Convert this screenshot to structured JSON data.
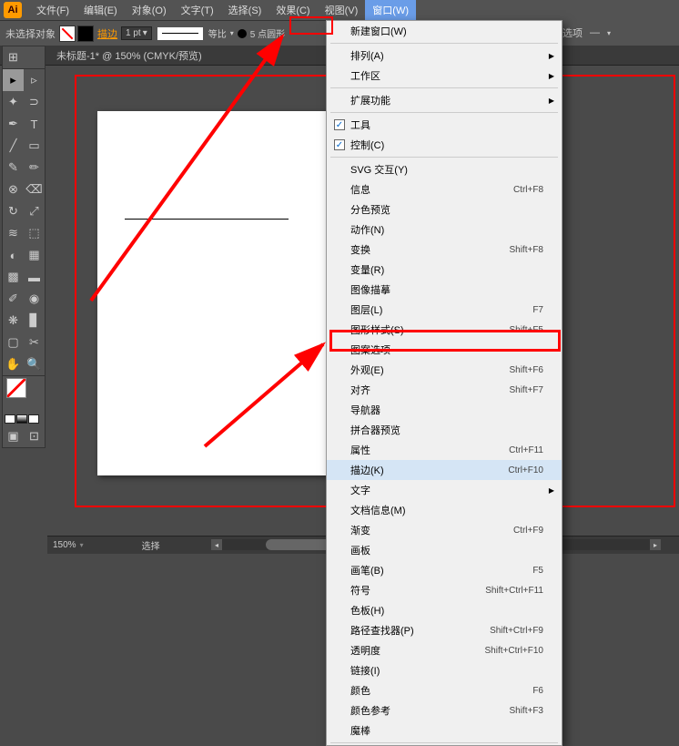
{
  "app": {
    "logo": "Ai"
  },
  "menubar": [
    {
      "label": "文件(F)"
    },
    {
      "label": "编辑(E)"
    },
    {
      "label": "对象(O)"
    },
    {
      "label": "文字(T)"
    },
    {
      "label": "选择(S)"
    },
    {
      "label": "效果(C)"
    },
    {
      "label": "视图(V)"
    },
    {
      "label": "窗口(W)",
      "active": true
    }
  ],
  "optionbar": {
    "noselection": "未选择对象",
    "stroke_link": "描边",
    "stroke_weight": "1 pt",
    "uniform": "等比",
    "shape_label": "5 点圆形"
  },
  "right_strip": {
    "option": "选项",
    "dash": "—"
  },
  "doc_tab": "未标题-1* @ 150% (CMYK/预览)",
  "menu": {
    "items": [
      {
        "label": "新建窗口(W)"
      },
      {
        "sep": true
      },
      {
        "label": "排列(A)",
        "sub": true
      },
      {
        "label": "工作区",
        "sub": true
      },
      {
        "sep": true
      },
      {
        "label": "扩展功能",
        "sub": true
      },
      {
        "sep": true
      },
      {
        "label": "工具",
        "checked": true
      },
      {
        "label": "控制(C)",
        "checked": true
      },
      {
        "sep": true
      },
      {
        "label": "SVG 交互(Y)"
      },
      {
        "label": "信息",
        "shortcut": "Ctrl+F8"
      },
      {
        "label": "分色预览"
      },
      {
        "label": "动作(N)"
      },
      {
        "label": "变换",
        "shortcut": "Shift+F8"
      },
      {
        "label": "变量(R)"
      },
      {
        "label": "图像描摹"
      },
      {
        "label": "图层(L)",
        "shortcut": "F7"
      },
      {
        "label": "图形样式(S)",
        "shortcut": "Shift+F5"
      },
      {
        "label": "图案选项"
      },
      {
        "label": "外观(E)",
        "shortcut": "Shift+F6"
      },
      {
        "label": "对齐",
        "shortcut": "Shift+F7"
      },
      {
        "label": "导航器"
      },
      {
        "label": "拼合器预览"
      },
      {
        "label": "属性",
        "shortcut": "Ctrl+F11"
      },
      {
        "label": "描边(K)",
        "shortcut": "Ctrl+F10",
        "highlighted": true
      },
      {
        "label": "文字",
        "sub": true
      },
      {
        "label": "文档信息(M)"
      },
      {
        "label": "渐变",
        "shortcut": "Ctrl+F9"
      },
      {
        "label": "画板"
      },
      {
        "label": "画笔(B)",
        "shortcut": "F5"
      },
      {
        "label": "符号",
        "shortcut": "Shift+Ctrl+F11"
      },
      {
        "label": "色板(H)"
      },
      {
        "label": "路径查找器(P)",
        "shortcut": "Shift+Ctrl+F9"
      },
      {
        "label": "透明度",
        "shortcut": "Shift+Ctrl+F10"
      },
      {
        "label": "链接(I)"
      },
      {
        "label": "颜色",
        "shortcut": "F6"
      },
      {
        "label": "颜色参考",
        "shortcut": "Shift+F3"
      },
      {
        "label": "魔棒"
      },
      {
        "sep": true
      }
    ]
  },
  "status": {
    "zoom": "150%",
    "select": "选择"
  }
}
